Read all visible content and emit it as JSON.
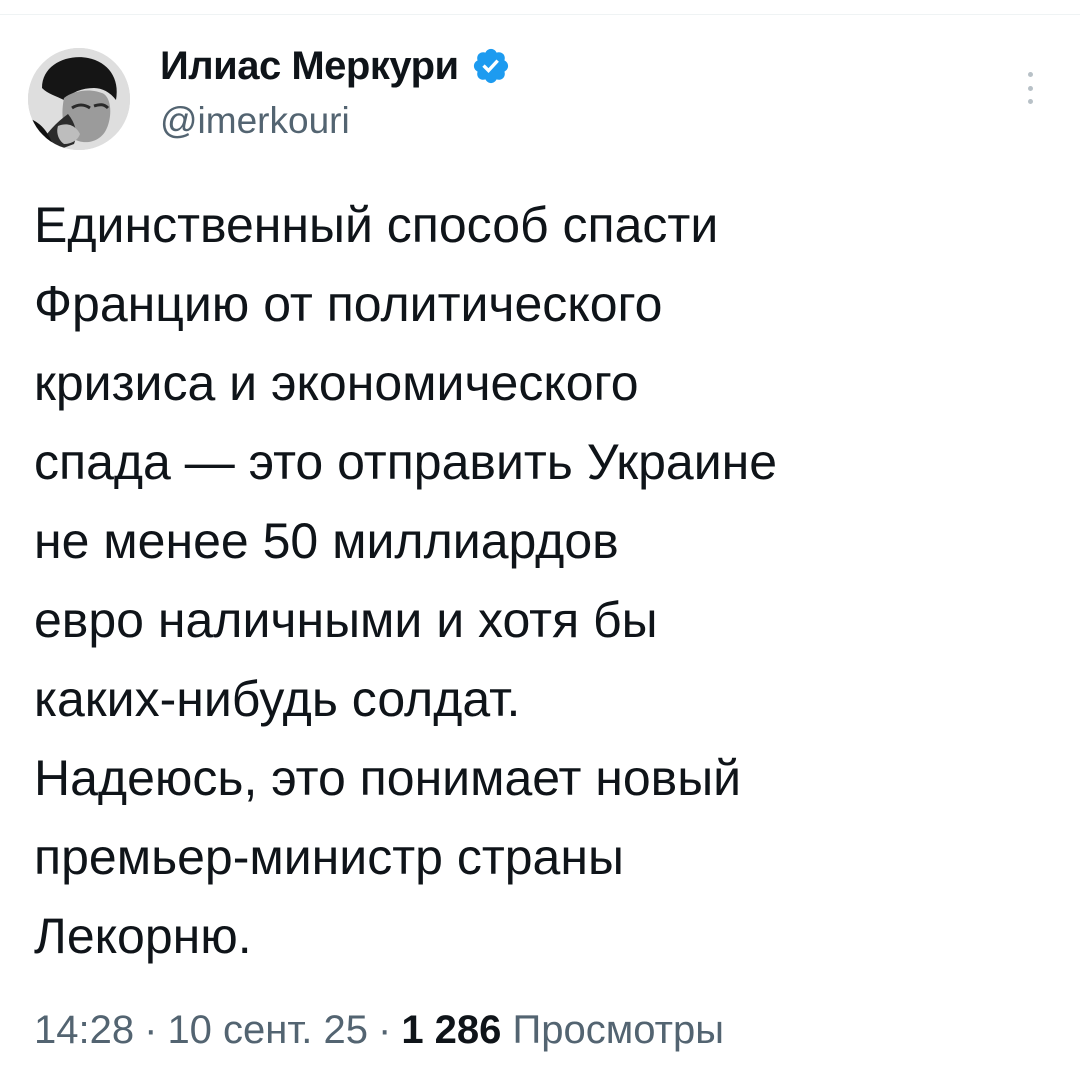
{
  "author": {
    "display_name": "Илиас Меркури",
    "handle": "@imerkouri",
    "avatar_icon": "profile-photo",
    "verified_icon": "verified-badge-icon",
    "verified_color": "#1d9bf0"
  },
  "more_icon": "vertical-ellipsis-icon",
  "tweet": {
    "lines": [
      "Единственный способ спасти",
      "Францию от политического",
      "кризиса и экономического",
      "спада — это отправить Украине",
      "не менее 50 миллиардов",
      "евро наличными и хотя бы",
      "каких-нибудь солдат.",
      "Надеюсь, это понимает новый",
      "премьер-министр страны",
      "Лекорню."
    ]
  },
  "meta": {
    "time": "14:28",
    "separator": "·",
    "date": "10 сент. 25",
    "views_count": "1 286",
    "views_label": "Просмотры"
  },
  "colors": {
    "text_primary": "#0f1419",
    "text_secondary": "#536471",
    "accent": "#1d9bf0"
  }
}
